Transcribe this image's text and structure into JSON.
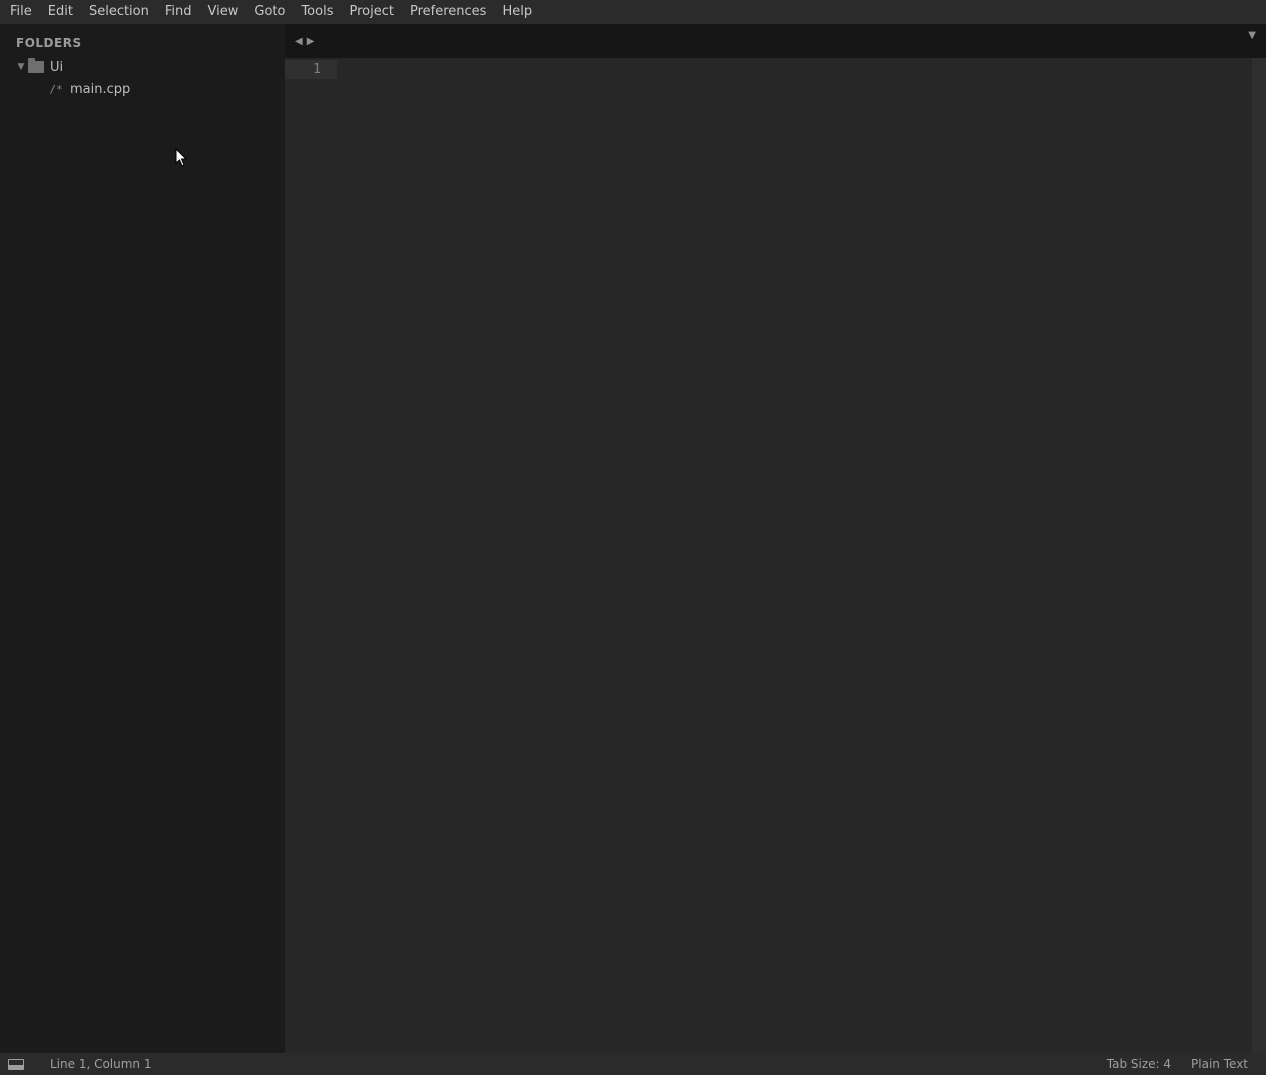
{
  "menu": {
    "items": [
      "File",
      "Edit",
      "Selection",
      "Find",
      "View",
      "Goto",
      "Tools",
      "Project",
      "Preferences",
      "Help"
    ]
  },
  "sidebar": {
    "header": "FOLDERS",
    "root_folder": "Ui",
    "files": [
      "main.cpp"
    ],
    "file_glyph": "/*"
  },
  "editor": {
    "gutter_lines": [
      "1"
    ]
  },
  "status": {
    "position": "Line 1, Column 1",
    "tab_size": "Tab Size: 4",
    "syntax": "Plain Text"
  }
}
